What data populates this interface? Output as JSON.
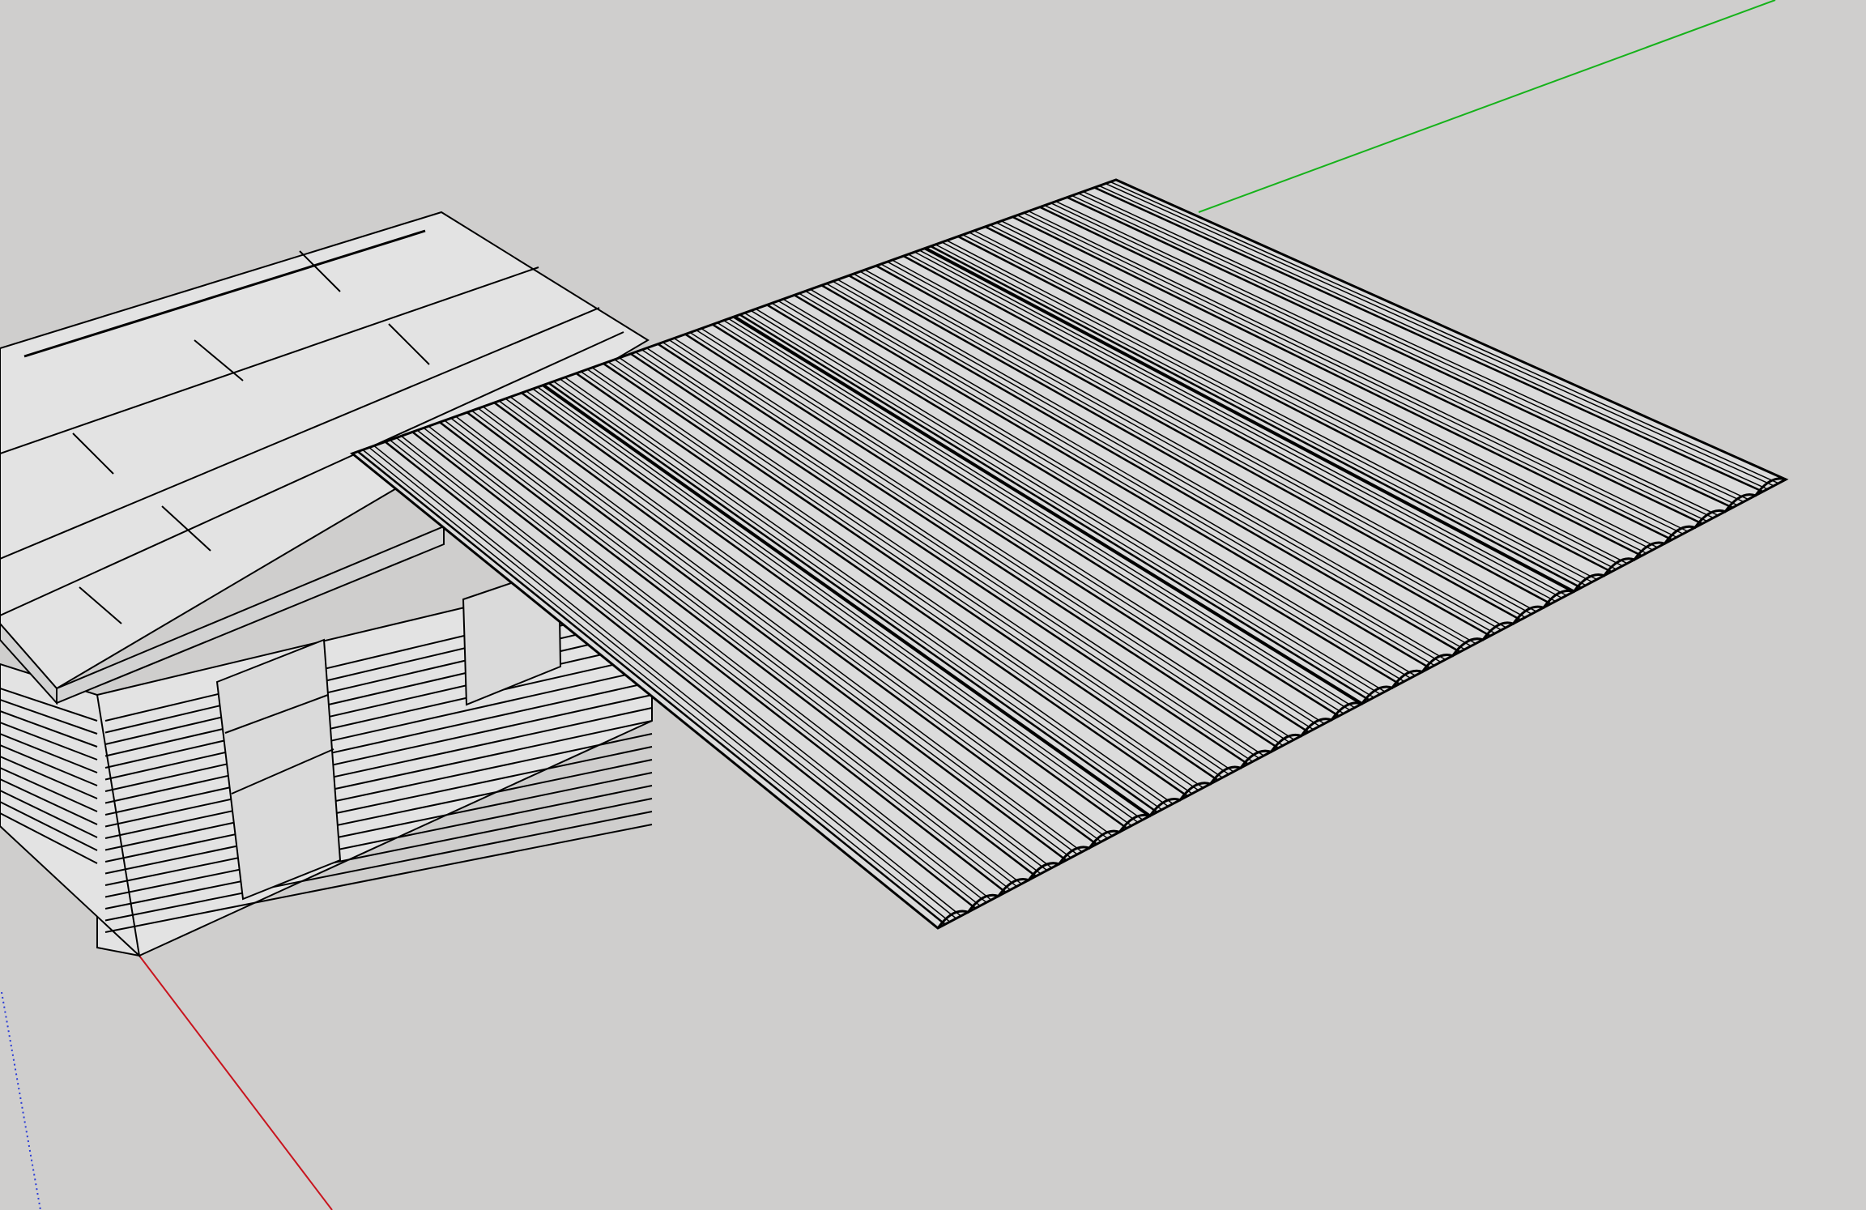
{
  "scene": {
    "background_color": "#cfcecd",
    "axis_colors": {
      "red": "#c8141e",
      "green": "#16b21a",
      "blue": "#2a3bd6"
    },
    "face_color": "#e3e3e3",
    "edge_color": "#000000",
    "objects": [
      "building",
      "corrugated-roof-sheet"
    ],
    "corrugated_sheet_ribs": 28
  }
}
